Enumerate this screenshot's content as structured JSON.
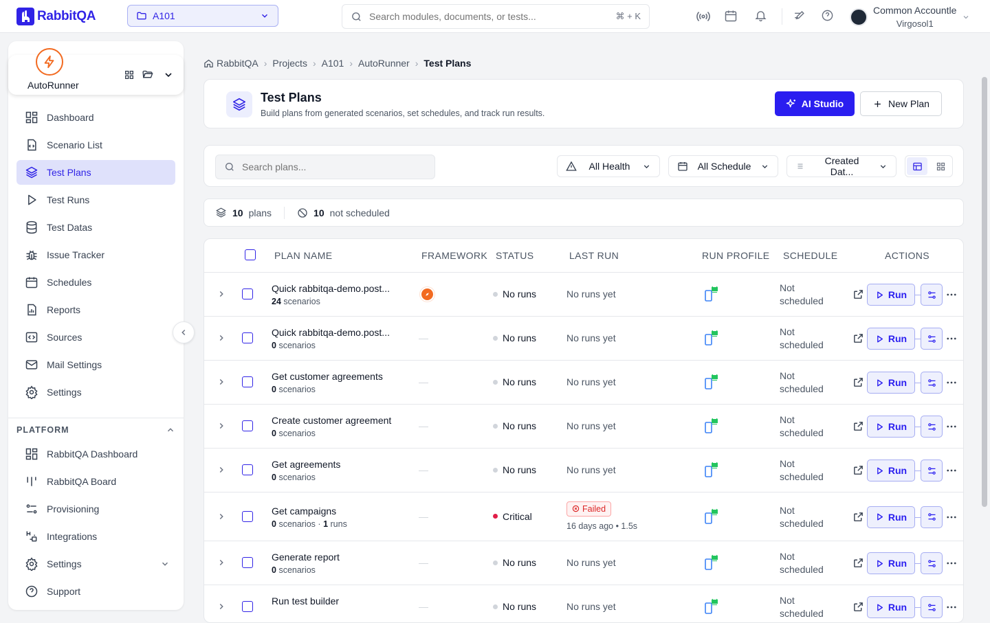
{
  "brand": {
    "name": "RabbitQA",
    "color": "#3023e6"
  },
  "project_selector": {
    "label": "A101"
  },
  "search": {
    "placeholder": "Search modules, documents, or tests...",
    "shortcut": "⌘ + K"
  },
  "user": {
    "line1": "Common Accountle",
    "line2": "Virgosol1"
  },
  "module": {
    "name": "AutoRunner"
  },
  "nav": [
    {
      "label": "Dashboard",
      "icon": "dashboard-icon"
    },
    {
      "label": "Scenario List",
      "icon": "file-code-icon"
    },
    {
      "label": "Test Plans",
      "icon": "layers-icon",
      "active": true
    },
    {
      "label": "Test Runs",
      "icon": "play-icon"
    },
    {
      "label": "Test Datas",
      "icon": "database-icon"
    },
    {
      "label": "Issue Tracker",
      "icon": "bug-icon"
    },
    {
      "label": "Schedules",
      "icon": "calendar-icon"
    },
    {
      "label": "Reports",
      "icon": "report-icon"
    },
    {
      "label": "Sources",
      "icon": "code-icon"
    },
    {
      "label": "Mail Settings",
      "icon": "mail-icon"
    },
    {
      "label": "Settings",
      "icon": "gear-icon"
    }
  ],
  "platform": {
    "title": "PLATFORM",
    "items": [
      {
        "label": "RabbitQA Dashboard",
        "icon": "dashboard-icon"
      },
      {
        "label": "RabbitQA Board",
        "icon": "board-icon"
      },
      {
        "label": "Provisioning",
        "icon": "provisioning-icon"
      },
      {
        "label": "Integrations",
        "icon": "integrations-icon"
      },
      {
        "label": "Settings",
        "icon": "gear-icon"
      },
      {
        "label": "Support",
        "icon": "help-icon"
      }
    ]
  },
  "breadcrumb": [
    "RabbitQA",
    "Projects",
    "A101",
    "AutoRunner",
    "Test Plans"
  ],
  "header": {
    "title": "Test Plans",
    "subtitle": "Build plans from generated scenarios, set schedules, and track run results.",
    "ai_label": "AI Studio",
    "new_label": "New Plan"
  },
  "filters": {
    "search_placeholder": "Search plans...",
    "health": "All Health",
    "schedule": "All Schedule",
    "sort": "Created Dat..."
  },
  "summary": {
    "plans_count": "10",
    "plans_label": "plans",
    "unscheduled_count": "10",
    "unscheduled_label": "not scheduled"
  },
  "table": {
    "columns": [
      "PLAN NAME",
      "FRAMEWORK",
      "STATUS",
      "LAST RUN",
      "RUN PROFILE",
      "SCHEDULE",
      "ACTIONS"
    ],
    "run_label": "Run",
    "rows": [
      {
        "name": "Quick rabbitqa-demo.post...",
        "count": "24",
        "count_label": "scenarios",
        "runs": "",
        "runs_label": "",
        "framework": "safari-icon",
        "framework_dash": "",
        "status": "No runs",
        "status_color": "#d1d5db",
        "last_run": "No runs yet",
        "schedule1": "Not",
        "schedule2": "scheduled"
      },
      {
        "name": "Quick rabbitqa-demo.post...",
        "count": "0",
        "count_label": "scenarios",
        "runs": "",
        "runs_label": "",
        "framework": "",
        "framework_dash": "—",
        "status": "No runs",
        "status_color": "#d1d5db",
        "last_run": "No runs yet",
        "schedule1": "Not",
        "schedule2": "scheduled"
      },
      {
        "name": "Get customer agreements",
        "count": "0",
        "count_label": "scenarios",
        "runs": "",
        "runs_label": "",
        "framework": "",
        "framework_dash": "—",
        "status": "No runs",
        "status_color": "#d1d5db",
        "last_run": "No runs yet",
        "schedule1": "Not",
        "schedule2": "scheduled"
      },
      {
        "name": "Create customer agreement",
        "count": "0",
        "count_label": "scenarios",
        "runs": "",
        "runs_label": "",
        "framework": "",
        "framework_dash": "—",
        "status": "No runs",
        "status_color": "#d1d5db",
        "last_run": "No runs yet",
        "schedule1": "Not",
        "schedule2": "scheduled"
      },
      {
        "name": "Get agreements",
        "count": "0",
        "count_label": "scenarios",
        "runs": "",
        "runs_label": "",
        "framework": "",
        "framework_dash": "—",
        "status": "No runs",
        "status_color": "#d1d5db",
        "last_run": "No runs yet",
        "schedule1": "Not",
        "schedule2": "scheduled"
      },
      {
        "name": "Get campaigns",
        "count": "0",
        "count_label": "scenarios ·",
        "runs": "1",
        "runs_label": "runs",
        "framework": "",
        "framework_dash": "—",
        "status": "Critical",
        "status_color": "#e11d48",
        "last_run": "",
        "badge": "Failed",
        "last_run_meta": "16 days ago • 1.5s",
        "schedule1": "Not",
        "schedule2": "scheduled"
      },
      {
        "name": "Generate report",
        "count": "0",
        "count_label": "scenarios",
        "runs": "",
        "runs_label": "",
        "framework": "",
        "framework_dash": "—",
        "status": "No runs",
        "status_color": "#d1d5db",
        "last_run": "No runs yet",
        "schedule1": "Not",
        "schedule2": "scheduled"
      },
      {
        "name": "Run test builder",
        "count": "",
        "count_label": "",
        "runs": "",
        "runs_label": "",
        "framework": "",
        "framework_dash": "—",
        "status": "No runs",
        "status_color": "#d1d5db",
        "last_run": "No runs yet",
        "schedule1": "Not",
        "schedule2": "scheduled"
      }
    ]
  }
}
